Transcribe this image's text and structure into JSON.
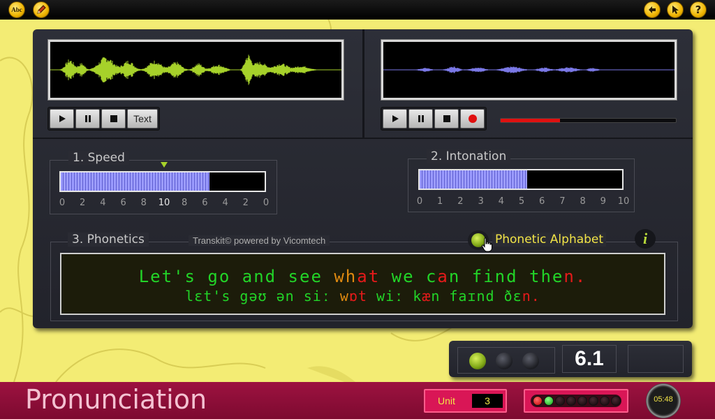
{
  "toolbar": {
    "abc_label": "Abc",
    "help_label": "?"
  },
  "speed": {
    "title": "1. Speed",
    "ticks": [
      "0",
      "2",
      "4",
      "6",
      "8",
      "10",
      "8",
      "6",
      "4",
      "2",
      "0"
    ],
    "level_percent": 73
  },
  "intonation": {
    "title": "2. Intonation",
    "ticks": [
      "0",
      "1",
      "2",
      "3",
      "4",
      "5",
      "6",
      "7",
      "8",
      "9",
      "10"
    ],
    "level_percent": 53
  },
  "phonetics": {
    "title": "3. Phonetics",
    "credit": "Transkit© powered by Vicomtech",
    "alphabet_label": "Phonetic Alphabet",
    "info_label": "i"
  },
  "sentence": {
    "line1": [
      {
        "t": "Let's go and see ",
        "c": "#22d428"
      },
      {
        "t": "wh",
        "c": "#e08a10"
      },
      {
        "t": "at",
        "c": "#e51a1a"
      },
      {
        "t": " we c",
        "c": "#22d428"
      },
      {
        "t": "a",
        "c": "#e51a1a"
      },
      {
        "t": "n find the",
        "c": "#22d428"
      },
      {
        "t": "n.",
        "c": "#e51a1a"
      }
    ],
    "line2": [
      {
        "t": "lɛt's gəʊ ən siː ",
        "c": "#22d428"
      },
      {
        "t": "w",
        "c": "#e08a10"
      },
      {
        "t": "ɒt",
        "c": "#e51a1a"
      },
      {
        "t": " wiː k",
        "c": "#22d428"
      },
      {
        "t": "æ",
        "c": "#e51a1a"
      },
      {
        "t": "n faɪnd ðɛ",
        "c": "#22d428"
      },
      {
        "t": "n.",
        "c": "#e51a1a"
      }
    ]
  },
  "recording": {
    "progress_percent": 34
  },
  "buttons": {
    "text_label": "Text"
  },
  "score": {
    "value": "6.1"
  },
  "footer": {
    "title": "Pronunciation",
    "unit_label": "Unit",
    "unit_value": "3",
    "progress_lights": [
      "red",
      "green",
      "off",
      "off",
      "off",
      "off",
      "off",
      "off"
    ],
    "timer": "05:48"
  },
  "colors": {
    "wave_left": "#a6d12a",
    "wave_right": "#7a78e6",
    "accent_yellow": "#f3ec74",
    "bar_fill": "#9c9cff",
    "footer_bg": "#8c0f38"
  }
}
